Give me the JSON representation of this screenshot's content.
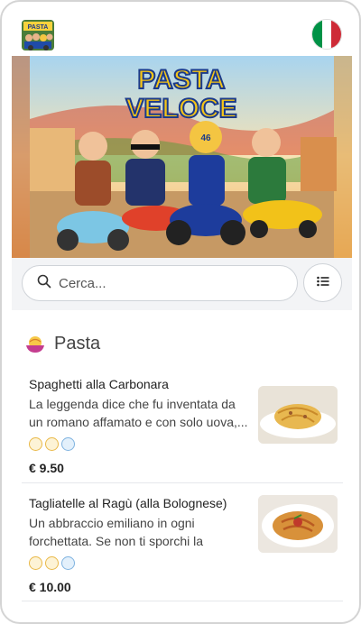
{
  "header": {
    "logo_name": "pasta-veloce-logo",
    "flag_name": "italy-flag-icon",
    "flag_colors": [
      "#009246",
      "#ffffff",
      "#ce2b37"
    ]
  },
  "hero": {
    "title_line1": "PASTA",
    "title_line2": "VELOCE",
    "helmet_number": "46"
  },
  "search": {
    "placeholder": "Cerca..."
  },
  "category": {
    "title": "Pasta"
  },
  "items": [
    {
      "name": "Spaghetti alla Carbonara",
      "description": "La leggenda dice che fu inventata da un romano affamato e con solo uova,...",
      "price": "€ 9.50",
      "allergen_icons": [
        "wheat-icon",
        "egg-icon",
        "milk-icon"
      ]
    },
    {
      "name": "Tagliatelle al Ragù (alla Bolognese)",
      "description": "Un abbraccio emiliano in ogni forchettata. Se non ti sporchi la camici...",
      "price": "€ 10.00",
      "allergen_icons": [
        "wheat-icon",
        "egg-icon",
        "milk-icon"
      ]
    }
  ]
}
